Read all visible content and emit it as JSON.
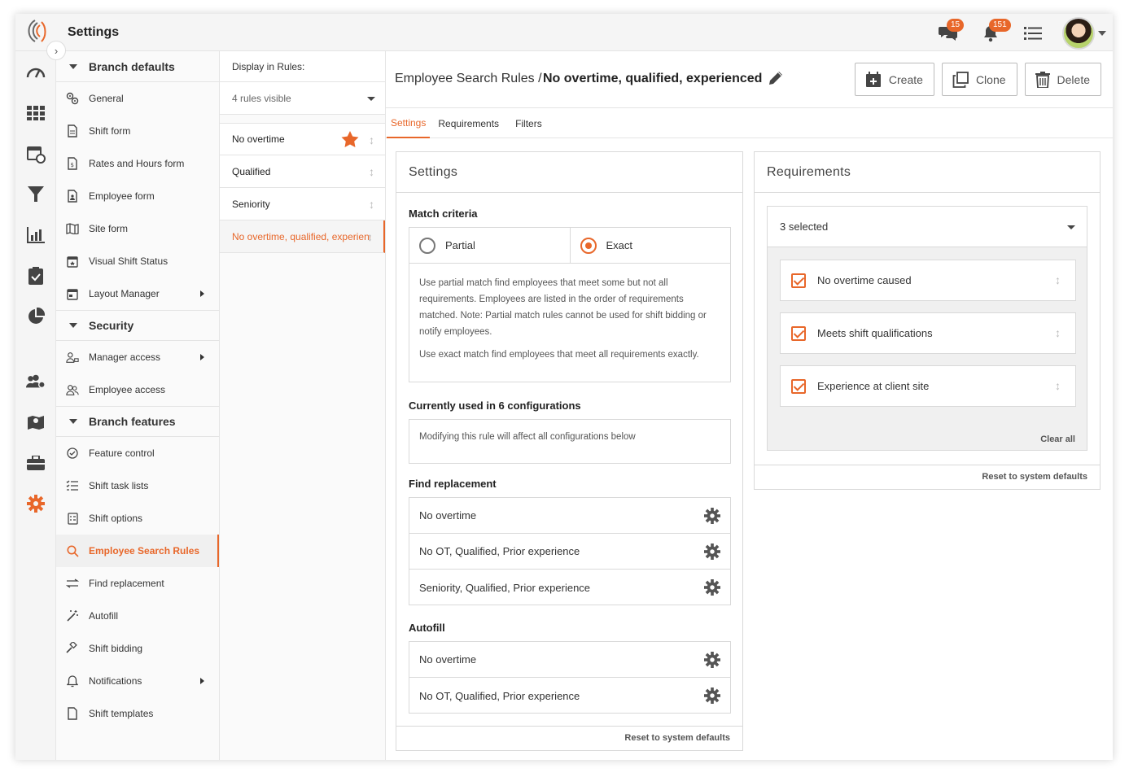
{
  "app": {
    "title": "Settings",
    "chat_badge": "15",
    "notif_badge": "151"
  },
  "nav": {
    "sections": {
      "branch_defaults": "Branch defaults",
      "security": "Security",
      "branch_features": "Branch features"
    },
    "items": {
      "general": "General",
      "shift_form": "Shift form",
      "rates_hours": "Rates and Hours form",
      "employee_form": "Employee form",
      "site_form": "Site form",
      "visual_shift_status": "Visual Shift Status",
      "layout_manager": "Layout Manager",
      "manager_access": "Manager access",
      "employee_access": "Employee access",
      "feature_control": "Feature control",
      "shift_task_lists": "Shift task lists",
      "shift_options": "Shift options",
      "employee_search_rules": "Employee Search Rules",
      "find_replacement": "Find replacement",
      "autofill": "Autofill",
      "shift_bidding": "Shift bidding",
      "notifications": "Notifications",
      "shift_templates": "Shift templates"
    }
  },
  "rules": {
    "header": "Display in Rules:",
    "filter_value": "4 rules visible",
    "items": [
      "No overtime",
      "Qualified",
      "Seniority",
      "No overtime, qualified, experienced"
    ]
  },
  "main": {
    "breadcrumb": "Employee Search Rules /",
    "title": "No overtime, qualified, experienced",
    "buttons": {
      "create": "Create",
      "clone": "Clone",
      "delete": "Delete"
    },
    "tabs": [
      "Settings",
      "Requirements",
      "Filters"
    ]
  },
  "settings_panel": {
    "title": "Settings",
    "match_criteria": "Match criteria",
    "partial": "Partial",
    "exact": "Exact",
    "selected": "exact",
    "desc1": "Use partial match find employees that meet some but not all requirements. Employees are listed in the order of requirements matched. Note: Partial match rules cannot be used for shift bidding or notify employees.",
    "desc2": "Use exact match find employees that meet all requirements exactly.",
    "used_in": "Currently used in 6 configurations",
    "used_note": "Modifying this rule will affect all configurations below",
    "find_replacement": "Find replacement",
    "find_items": [
      "No overtime",
      "No OT, Qualified, Prior experience",
      "Seniority, Qualified, Prior experience"
    ],
    "autofill": "Autofill",
    "autofill_items": [
      "No overtime",
      "No OT, Qualified, Prior experience"
    ],
    "reset": "Reset to system defaults"
  },
  "requirements_panel": {
    "title": "Requirements",
    "select_value": "3 selected",
    "items": [
      "No overtime caused",
      "Meets shift qualifications",
      "Experience at client site"
    ],
    "clear_all": "Clear all",
    "reset": "Reset to system defaults"
  },
  "colors": {
    "accent": "#e8672a"
  }
}
